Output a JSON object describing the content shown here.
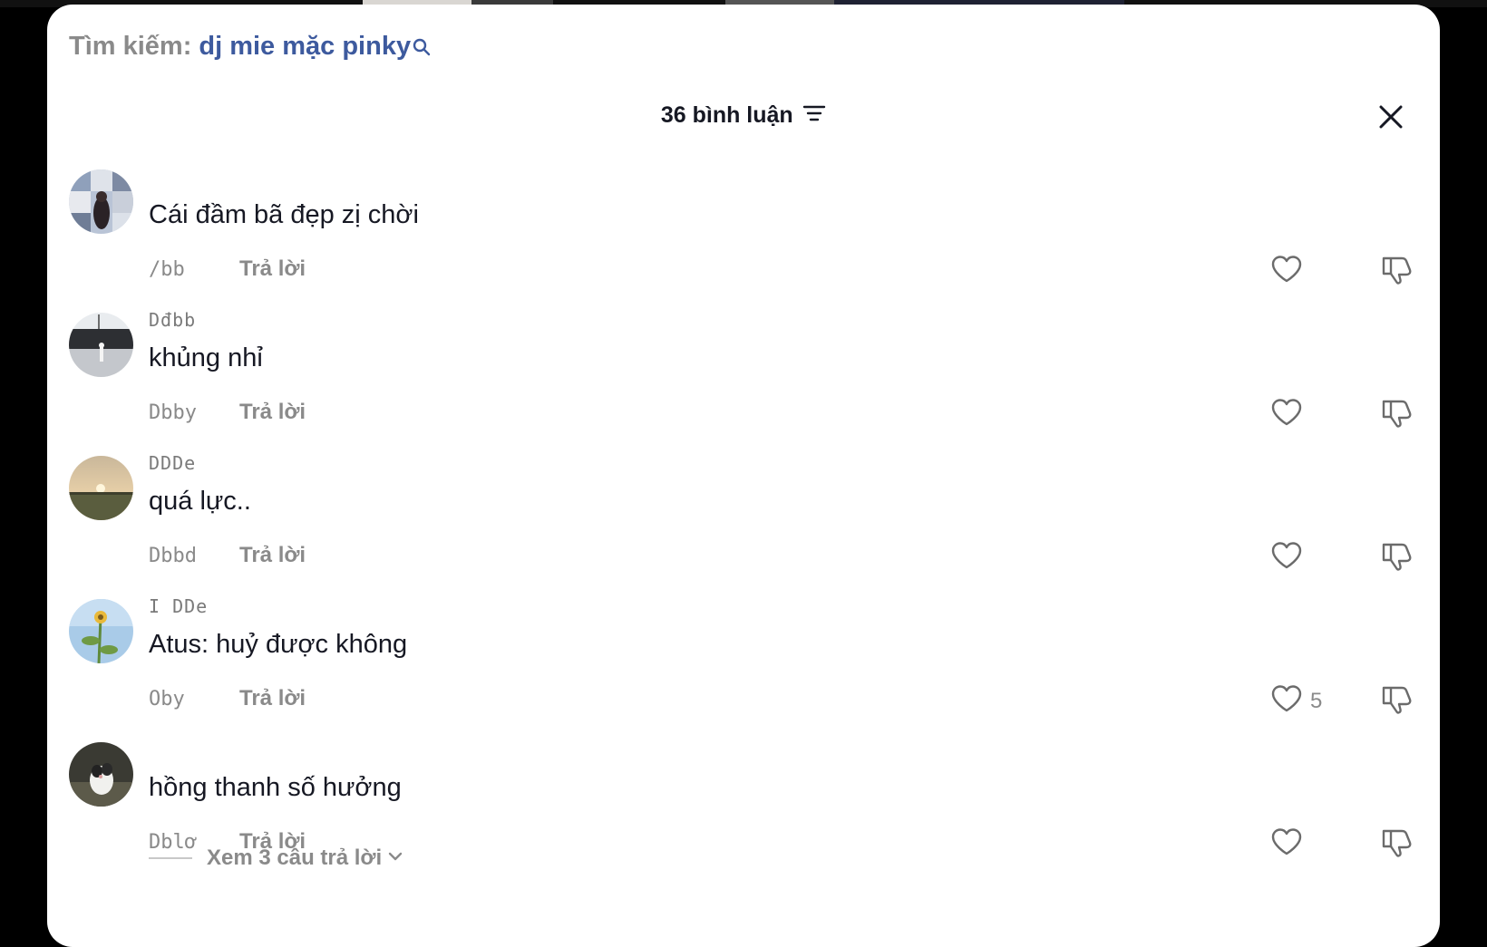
{
  "search": {
    "prefix": "Tìm kiếm:",
    "query": "dj mie mặc pinky"
  },
  "header": {
    "comment_count": "36 bình luận"
  },
  "icons": {
    "search": "search-icon",
    "filter": "filter-icon",
    "close": "close-icon",
    "like": "heart-icon",
    "dislike": "thumbs-down-icon",
    "chevron": "chevron-down-icon"
  },
  "comments": [
    {
      "username": "",
      "text": "Cái đầm bã đẹp zị chời",
      "timestamp": "/bb",
      "reply_label": "Trả lời",
      "likes": ""
    },
    {
      "username": "Dđbb",
      "text": "khủng nhỉ",
      "timestamp": "Dbby",
      "reply_label": "Trả lời",
      "likes": ""
    },
    {
      "username": "DDDe",
      "text": "quá lực..",
      "timestamp": "Dbbd",
      "reply_label": "Trả lời",
      "likes": ""
    },
    {
      "username": "I DDe",
      "text": "Atus: huỷ được không",
      "timestamp": "Oby",
      "reply_label": "Trả lời",
      "likes": "5"
    },
    {
      "username": "",
      "text": "hồng thanh số hưởng",
      "timestamp": "Dblơ",
      "reply_label": "Trả lời",
      "likes": ""
    }
  ],
  "view_replies": {
    "label": "Xem 3 câu trả lời"
  }
}
